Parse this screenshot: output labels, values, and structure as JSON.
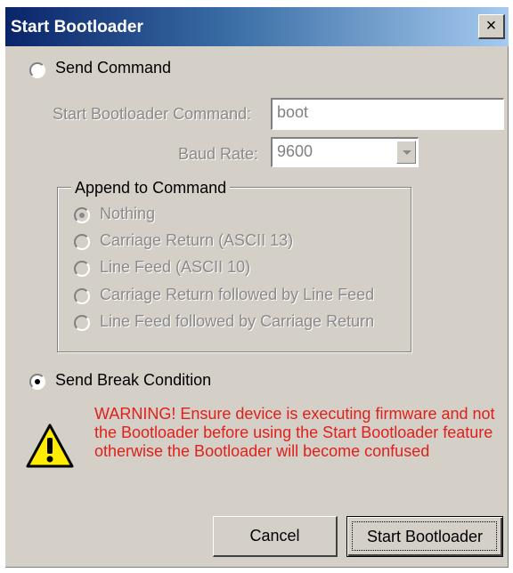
{
  "window": {
    "title": "Start Bootloader",
    "close_label": "×"
  },
  "send_command": {
    "label": "Send Command",
    "selected": false
  },
  "command_field": {
    "label": "Start Bootloader Command:",
    "value": "boot"
  },
  "baud_rate": {
    "label": "Baud Rate:",
    "value": "9600"
  },
  "append_group": {
    "label": "Append to Command",
    "options": [
      {
        "label": "Nothing",
        "selected": true
      },
      {
        "label": "Carriage Return (ASCII 13)",
        "selected": false
      },
      {
        "label": "Line Feed (ASCII 10)",
        "selected": false
      },
      {
        "label": "Carriage Return followed by Line Feed",
        "selected": false
      },
      {
        "label": "Line Feed followed by Carriage Return",
        "selected": false
      }
    ]
  },
  "send_break": {
    "label": "Send Break Condition",
    "selected": true
  },
  "warning": {
    "icon": "warning-icon",
    "text": "WARNING! Ensure device is executing firmware and not the Bootloader before using the Start Bootloader feature otherwise the Bootloader will become confused",
    "color": "#e0201b"
  },
  "buttons": {
    "cancel": "Cancel",
    "start": "Start Bootloader"
  },
  "colors": {
    "face": "#d4d0c8",
    "title_start": "#0a246a",
    "title_end": "#a6caf0"
  }
}
